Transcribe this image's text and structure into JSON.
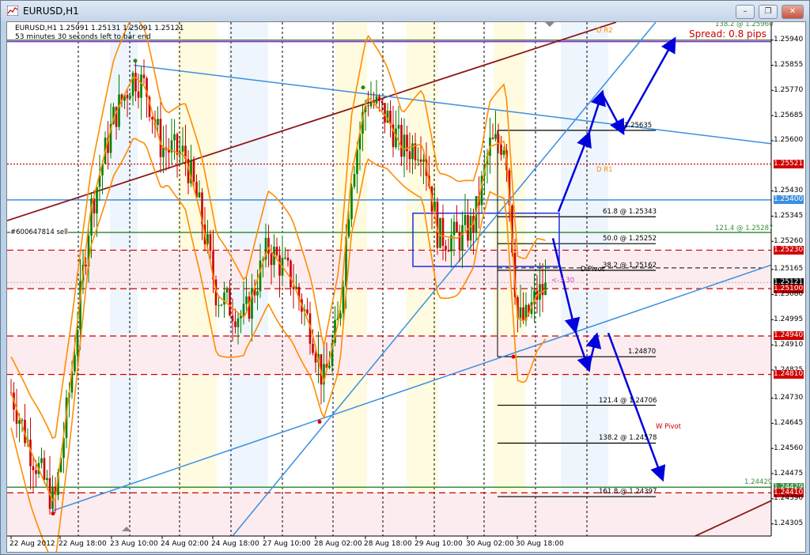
{
  "window": {
    "title": "EURUSD,H1",
    "minimize": "–",
    "restore": "❐",
    "close": "✕"
  },
  "info": {
    "line1": "EURUSD,H1  1.25091  1.25131  1.25091  1.25121",
    "line2": "53 minutes 30 seconds left to bar end"
  },
  "spread": "Spread: 0.8 pips",
  "order_label": "#600647814 sell",
  "colors": {
    "bull_candle": "#008000",
    "bear_candle": "#cc0000",
    "bollinger": "#ff8c00",
    "trendline": "#3a8fe0",
    "support_res": "#d00000",
    "arrows": "#0000dd",
    "fib_green": "#3c8c3c",
    "purple": "#a020f0",
    "brown": "#8b1a1a",
    "highlight_price": "#cc0000",
    "current_price": "#000000"
  },
  "chart_data": {
    "type": "candlestick",
    "symbol": "EURUSD",
    "timeframe": "H1",
    "ohlc_current": {
      "open": 1.25091,
      "high": 1.25131,
      "low": 1.25091,
      "close": 1.25121
    },
    "y_range": [
      1.2428,
      1.2599
    ],
    "price_axis": [
      {
        "p": 1.2594,
        "text": "1.25940"
      },
      {
        "p": 1.25855,
        "text": "1.25855"
      },
      {
        "p": 1.2577,
        "text": "1.25770"
      },
      {
        "p": 1.25685,
        "text": "1.25685"
      },
      {
        "p": 1.256,
        "text": "1.25600"
      },
      {
        "p": 1.25521,
        "text": "1.25521",
        "hl": "red"
      },
      {
        "p": 1.2543,
        "text": "1.25430"
      },
      {
        "p": 1.254,
        "text": "1.25400",
        "hl": "blue"
      },
      {
        "p": 1.25345,
        "text": "1.25345"
      },
      {
        "p": 1.2526,
        "text": "1.25260"
      },
      {
        "p": 1.2523,
        "text": "1.25230",
        "hl": "red"
      },
      {
        "p": 1.25165,
        "text": "1.25165"
      },
      {
        "p": 1.25121,
        "text": "1.25121",
        "hl": "black"
      },
      {
        "p": 1.251,
        "text": "1.25100",
        "hl": "red"
      },
      {
        "p": 1.2508,
        "text": "1.25080"
      },
      {
        "p": 1.24995,
        "text": "1.24995"
      },
      {
        "p": 1.2494,
        "text": "1.24940",
        "hl": "red"
      },
      {
        "p": 1.2491,
        "text": "1.24910"
      },
      {
        "p": 1.24825,
        "text": "1.24825"
      },
      {
        "p": 1.2481,
        "text": "1.24810",
        "hl": "red"
      },
      {
        "p": 1.2473,
        "text": "1.24730"
      },
      {
        "p": 1.24645,
        "text": "1.24645"
      },
      {
        "p": 1.2456,
        "text": "1.24560"
      },
      {
        "p": 1.24475,
        "text": "1.24475"
      },
      {
        "p": 1.24429,
        "text": "1.24429",
        "hl": "green"
      },
      {
        "p": 1.2441,
        "text": "1.24410",
        "hl": "red"
      },
      {
        "p": 1.2439,
        "text": "1.24390"
      },
      {
        "p": 1.24305,
        "text": "1.24305"
      }
    ],
    "time_axis": [
      "22 Aug 2012",
      "22 Aug 18:00",
      "23 Aug 10:00",
      "24 Aug 02:00",
      "24 Aug 18:00",
      "27 Aug 10:00",
      "28 Aug 02:00",
      "28 Aug 18:00",
      "29 Aug 10:00",
      "30 Aug 02:00",
      "30 Aug 18:00"
    ],
    "horizontal_levels": [
      {
        "p": 1.2594,
        "style": "solid",
        "color": "#3c8c3c"
      },
      {
        "p": 1.25935,
        "style": "solid",
        "color": "#a020f0"
      },
      {
        "p": 1.25521,
        "style": "dotted",
        "color": "#d00000"
      },
      {
        "p": 1.254,
        "style": "solid",
        "color": "#3a8fe0"
      },
      {
        "p": 1.2529,
        "style": "solid",
        "color": "#3c8c3c"
      },
      {
        "p": 1.2523,
        "style": "dashed",
        "color": "#d00000"
      },
      {
        "p": 1.251,
        "style": "dashed",
        "color": "#d00000"
      },
      {
        "p": 1.2494,
        "style": "dashed",
        "color": "#d00000"
      },
      {
        "p": 1.2481,
        "style": "dashed",
        "color": "#d00000"
      },
      {
        "p": 1.24429,
        "style": "solid",
        "color": "#3c8c3c"
      },
      {
        "p": 1.2441,
        "style": "dashed",
        "color": "#d00000"
      }
    ],
    "fib_levels": [
      {
        "p": 1.25635,
        "text": "1.25635"
      },
      {
        "p": 1.25343,
        "text": "61.8 @ 1.25343"
      },
      {
        "p": 1.25252,
        "text": "50.0 @ 1.25252"
      },
      {
        "p": 1.25162,
        "text": "38.2 @ 1.25162"
      },
      {
        "p": 1.2487,
        "text": "1.24870"
      },
      {
        "p": 1.24706,
        "text": "121.4 @ 1.24706"
      },
      {
        "p": 1.24578,
        "text": "138.2 @ 1.24578"
      },
      {
        "p": 1.24397,
        "text": "161.8 @ 1.24397"
      }
    ],
    "annotations": [
      {
        "text": "121.4 @ 1.25287",
        "color": "#3c8c3c"
      },
      {
        "text": "138.2 @ 1.25960",
        "color": "#3c8c3c"
      },
      {
        "text": "D R2",
        "color": "#ff8c00"
      },
      {
        "text": "D R1",
        "color": "#ff8c00"
      },
      {
        "text": "D Pivot",
        "color": "#000000"
      },
      {
        "text": "W Pivot",
        "color": "#cc0000"
      },
      {
        "text": "1.24429",
        "color": "#3c8c3c"
      },
      {
        "text": "<-3.30",
        "color": "#cc44cc"
      }
    ],
    "indicators": [
      "Bollinger Bands",
      "Trendlines",
      "Fibonacci retracement",
      "Pivot points"
    ]
  }
}
